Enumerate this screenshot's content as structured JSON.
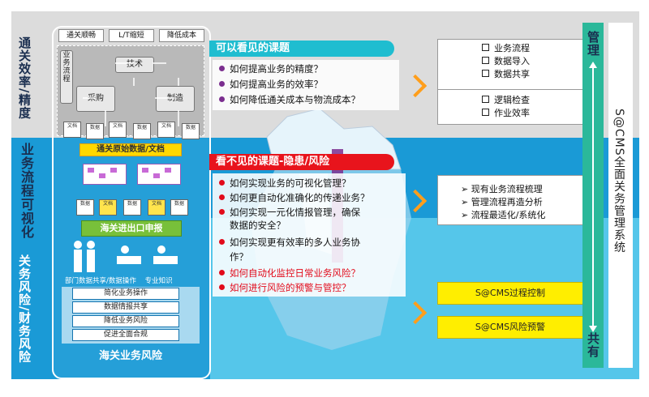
{
  "left_labels": {
    "top": "通关效率/精度",
    "middle": "业务流程可视化",
    "bottom": "关务风险/财务风险"
  },
  "left_panel": {
    "top_buttons": [
      "通关顺畅",
      "L/T缩短",
      "降低成本"
    ],
    "process_nodes": {
      "vertical": "业务流程",
      "tech": "技术",
      "purchase": "采购",
      "manufacture": "制造"
    },
    "docs_row1": [
      "文档",
      "数据",
      "文档",
      "数据",
      "文档",
      "数据"
    ],
    "orange_bar": "通关原始数据/文档",
    "docs_row2": [
      "数据",
      "文档",
      "数据",
      "文档",
      "数据"
    ],
    "green_bar": "海关进出口申报",
    "people_caption": "部门数据共享/数据操作    专业知识",
    "list": [
      "简化业务操作",
      "数据情报共享",
      "降低业务风险",
      "促进全面合规"
    ],
    "footer": "海关业务风险"
  },
  "visible": {
    "title": "可以看见的课题",
    "questions": [
      "如何提高业务的精度？",
      "如何提高业务的效率？",
      "如何降低通关成本与物流成本？"
    ]
  },
  "hidden": {
    "title": "看不见的课题-隐患/风险",
    "questions": [
      "如何实现业务的可视化管理？",
      "如何更自动化准确化的传递业务？",
      "如何实现一元化情报管理，确保",
      "数据的安全？",
      "如何实现更有效率的多人业务协",
      "作？"
    ],
    "red_questions": [
      "如何自动化监控日常业务风险？",
      "如何进行风险的预警与管控？"
    ]
  },
  "right": {
    "box1": [
      "业务流程",
      "数据导入",
      "数据共享"
    ],
    "box2": [
      "逻辑检查",
      "作业效率"
    ],
    "box3": [
      "现有业务流程梳理",
      "管理流程再造分析",
      "流程最适化/系统化"
    ],
    "box3_marker": "➢",
    "yellow1": "S@CMS过程控制",
    "yellow2": "S@CMS风险预警",
    "col_top": "管理",
    "col_bottom": "共有",
    "side_title": "S@CMS全面关务管理系统"
  },
  "colors": {
    "accent_cyan": "#1fbdd0",
    "accent_red": "#e8141c",
    "accent_orange": "#ff9e1b",
    "sky_blue": "#1a9ad6"
  }
}
